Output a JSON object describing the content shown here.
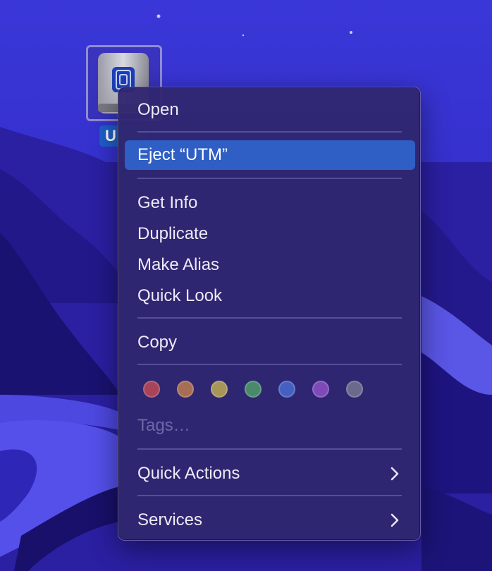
{
  "desktop": {
    "disk_label": "U",
    "disk_icon": "external-disk-icon"
  },
  "menu": {
    "items": {
      "open": "Open",
      "eject": "Eject “UTM”",
      "get_info": "Get Info",
      "duplicate": "Duplicate",
      "make_alias": "Make Alias",
      "quick_look": "Quick Look",
      "copy": "Copy",
      "tags": "Tags…",
      "quick_actions": "Quick Actions",
      "services": "Services"
    },
    "highlight_color": "#2f5fc4",
    "tag_colors": [
      {
        "name": "red",
        "color": "#a8445a"
      },
      {
        "name": "orange",
        "color": "#a86d55"
      },
      {
        "name": "yellow",
        "color": "#a8955a"
      },
      {
        "name": "green",
        "color": "#4a8a6a"
      },
      {
        "name": "blue",
        "color": "#4560c0"
      },
      {
        "name": "purple",
        "color": "#7d4ab8"
      },
      {
        "name": "gray",
        "color": "#6b6a8c"
      }
    ],
    "submenu_icon": "chevron-right-icon"
  }
}
